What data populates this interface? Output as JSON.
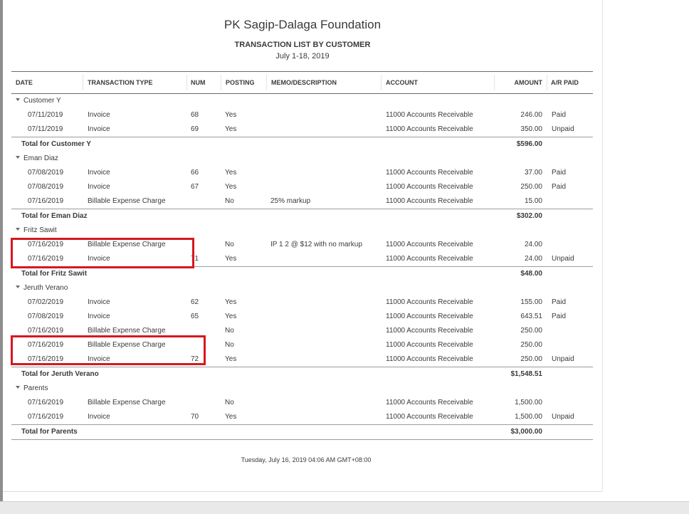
{
  "report": {
    "company": "PK Sagip-Dalaga Foundation",
    "title": "TRANSACTION LIST BY CUSTOMER",
    "date_range": "July 1-18, 2019",
    "footer": "Tuesday, July 16, 2019  04:06 AM GMT+08:00"
  },
  "columns": {
    "date": "DATE",
    "type": "TRANSACTION TYPE",
    "num": "NUM",
    "posting": "POSTING",
    "memo": "MEMO/DESCRIPTION",
    "account": "ACCOUNT",
    "amount": "AMOUNT",
    "paid": "A/R PAID"
  },
  "groups": [
    {
      "name": "Customer Y",
      "rows": [
        {
          "date": "07/11/2019",
          "type": "Invoice",
          "num": "68",
          "posting": "Yes",
          "memo": "",
          "account": "11000 Accounts Receivable",
          "amount": "246.00",
          "paid": "Paid"
        },
        {
          "date": "07/11/2019",
          "type": "Invoice",
          "num": "69",
          "posting": "Yes",
          "memo": "",
          "account": "11000 Accounts Receivable",
          "amount": "350.00",
          "paid": "Unpaid"
        }
      ],
      "total_label": "Total for Customer Y",
      "total": "$596.00"
    },
    {
      "name": "Eman Diaz",
      "rows": [
        {
          "date": "07/08/2019",
          "type": "Invoice",
          "num": "66",
          "posting": "Yes",
          "memo": "",
          "account": "11000 Accounts Receivable",
          "amount": "37.00",
          "paid": "Paid"
        },
        {
          "date": "07/08/2019",
          "type": "Invoice",
          "num": "67",
          "posting": "Yes",
          "memo": "",
          "account": "11000 Accounts Receivable",
          "amount": "250.00",
          "paid": "Paid"
        },
        {
          "date": "07/16/2019",
          "type": "Billable Expense Charge",
          "num": "",
          "posting": "No",
          "memo": "25% markup",
          "account": "11000 Accounts Receivable",
          "amount": "15.00",
          "paid": ""
        }
      ],
      "total_label": "Total for Eman Diaz",
      "total": "$302.00"
    },
    {
      "name": "Fritz Sawit",
      "rows": [
        {
          "date": "07/16/2019",
          "type": "Billable Expense Charge",
          "num": "",
          "posting": "No",
          "memo": "IP 1 2 @ $12 with no markup",
          "account": "11000 Accounts Receivable",
          "amount": "24.00",
          "paid": ""
        },
        {
          "date": "07/16/2019",
          "type": "Invoice",
          "num": "71",
          "posting": "Yes",
          "memo": "",
          "account": "11000 Accounts Receivable",
          "amount": "24.00",
          "paid": "Unpaid"
        }
      ],
      "total_label": "Total for Fritz Sawit",
      "total": "$48.00"
    },
    {
      "name": "Jeruth Verano",
      "rows": [
        {
          "date": "07/02/2019",
          "type": "Invoice",
          "num": "62",
          "posting": "Yes",
          "memo": "",
          "account": "11000 Accounts Receivable",
          "amount": "155.00",
          "paid": "Paid"
        },
        {
          "date": "07/08/2019",
          "type": "Invoice",
          "num": "65",
          "posting": "Yes",
          "memo": "",
          "account": "11000 Accounts Receivable",
          "amount": "643.51",
          "paid": "Paid"
        },
        {
          "date": "07/16/2019",
          "type": "Billable Expense Charge",
          "num": "",
          "posting": "No",
          "memo": "",
          "account": "11000 Accounts Receivable",
          "amount": "250.00",
          "paid": ""
        },
        {
          "date": "07/16/2019",
          "type": "Billable Expense Charge",
          "num": "",
          "posting": "No",
          "memo": "",
          "account": "11000 Accounts Receivable",
          "amount": "250.00",
          "paid": ""
        },
        {
          "date": "07/16/2019",
          "type": "Invoice",
          "num": "72",
          "posting": "Yes",
          "memo": "",
          "account": "11000 Accounts Receivable",
          "amount": "250.00",
          "paid": "Unpaid"
        }
      ],
      "total_label": "Total for Jeruth Verano",
      "total": "$1,548.51"
    },
    {
      "name": "Parents",
      "rows": [
        {
          "date": "07/16/2019",
          "type": "Billable Expense Charge",
          "num": "",
          "posting": "No",
          "memo": "",
          "account": "11000 Accounts Receivable",
          "amount": "1,500.00",
          "paid": ""
        },
        {
          "date": "07/16/2019",
          "type": "Invoice",
          "num": "70",
          "posting": "Yes",
          "memo": "",
          "account": "11000 Accounts Receivable",
          "amount": "1,500.00",
          "paid": "Unpaid"
        }
      ],
      "total_label": "Total for Parents",
      "total": "$3,000.00"
    }
  ],
  "annotation_color": "#d6181f"
}
